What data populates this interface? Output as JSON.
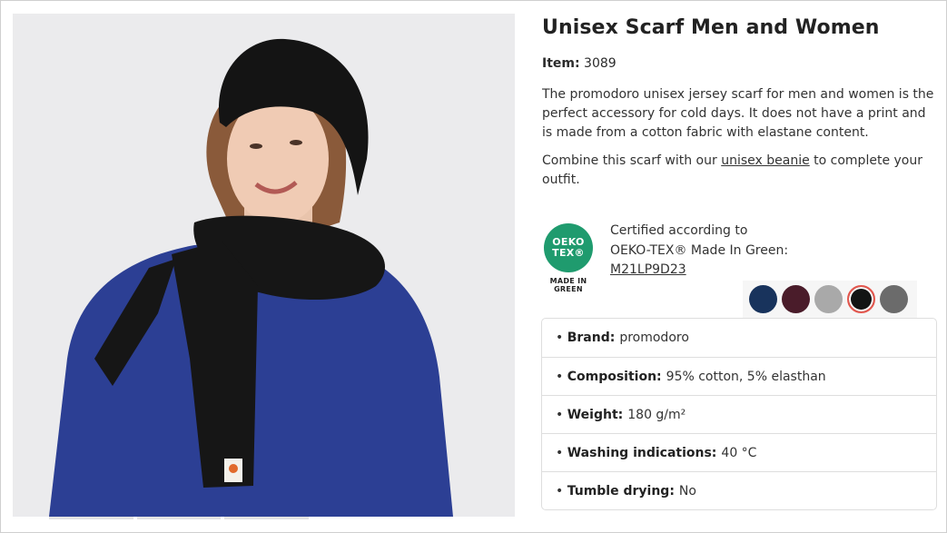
{
  "product": {
    "title": "Unisex Scarf Men and Women",
    "item_label": "Item:",
    "item_number": "3089",
    "description": "The promodoro unisex jersey scarf for men and women is the perfect accessory for cold days. It does not have a print and is made from a cotton fabric with elastane content.",
    "combine_prefix": "Combine this scarf with our",
    "combine_link": "unisex beanie",
    "combine_suffix": "to complete your outfit."
  },
  "certification": {
    "badge_line1": "OEKO",
    "badge_line2": "TEX®",
    "badge_sub1": "MADE IN",
    "badge_sub2": "GREEN",
    "line1": "Certified according to",
    "line2": "OEKO-TEX® Made In Green:",
    "code": "M21LP9D23",
    "badge_color": "#1f9b6e"
  },
  "colors": [
    {
      "name": "navy",
      "hex": "#18335c",
      "selected": false
    },
    {
      "name": "burgundy",
      "hex": "#4a1c2a",
      "selected": false
    },
    {
      "name": "heather-grey",
      "hex": "#a9a9a9",
      "selected": false
    },
    {
      "name": "black",
      "hex": "#121414",
      "selected": true
    },
    {
      "name": "graphite",
      "hex": "#6b6b6b",
      "selected": false
    }
  ],
  "properties": [
    {
      "label": "Brand:",
      "value": "promodoro"
    },
    {
      "label": "Composition:",
      "value": "95% cotton, 5% elasthan"
    },
    {
      "label": "Weight:",
      "value": "180 g/m²"
    },
    {
      "label": "Washing indications:",
      "value": "40 °C"
    },
    {
      "label": "Tumble drying:",
      "value": "No"
    }
  ]
}
